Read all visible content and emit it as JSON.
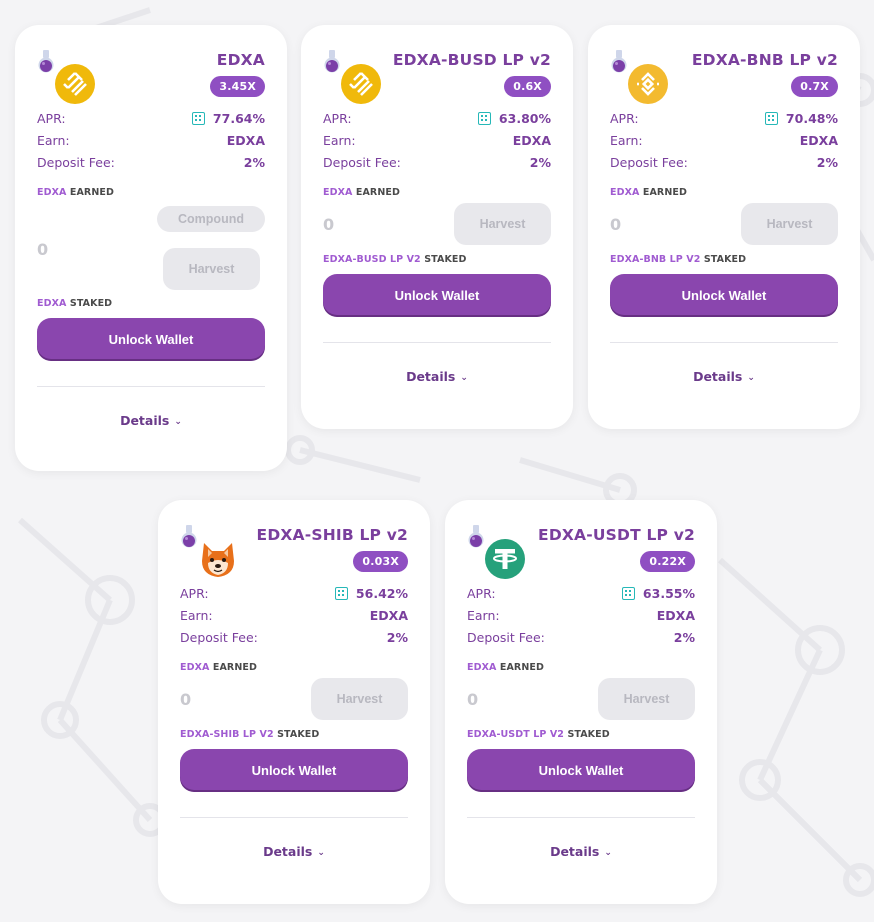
{
  "labels": {
    "apr": "APR:",
    "earn": "Earn:",
    "deposit_fee": "Deposit Fee:",
    "earned_suffix": "EARNED",
    "staked_suffix": "STAKED",
    "unlock_wallet": "Unlock Wallet",
    "details": "Details",
    "harvest": "Harvest",
    "compound": "Compound"
  },
  "colors": {
    "accent_purple": "#8a46ae",
    "title_purple": "#7a3f9d",
    "badge_purple": "#8f4fc2",
    "calc_teal": "#26b8b8",
    "binance_yellow": "#f0b90b",
    "tether_green": "#26a17b"
  },
  "farms": [
    {
      "name": "EDXA",
      "multiplier": "3.45X",
      "apr": "77.64%",
      "earn": "EDXA",
      "deposit_fee": "2%",
      "earned_token": "EDXA",
      "earned_amount": "0",
      "staked_token": "EDXA",
      "icon": "busd-icon"
    },
    {
      "name": "EDXA-BUSD LP v2",
      "multiplier": "0.6X",
      "apr": "63.80%",
      "earn": "EDXA",
      "deposit_fee": "2%",
      "earned_token": "EDXA",
      "earned_amount": "0",
      "staked_token": "EDXA-BUSD LP V2",
      "icon": "busd-icon"
    },
    {
      "name": "EDXA-BNB LP v2",
      "multiplier": "0.7X",
      "apr": "70.48%",
      "earn": "EDXA",
      "deposit_fee": "2%",
      "earned_token": "EDXA",
      "earned_amount": "0",
      "staked_token": "EDXA-BNB LP V2",
      "icon": "bnb-icon"
    },
    {
      "name": "EDXA-SHIB LP v2",
      "multiplier": "0.03X",
      "apr": "56.42%",
      "earn": "EDXA",
      "deposit_fee": "2%",
      "earned_token": "EDXA",
      "earned_amount": "0",
      "staked_token": "EDXA-SHIB LP V2",
      "icon": "shib-icon"
    },
    {
      "name": "EDXA-USDT LP v2",
      "multiplier": "0.22X",
      "apr": "63.55%",
      "earn": "EDXA",
      "deposit_fee": "2%",
      "earned_token": "EDXA",
      "earned_amount": "0",
      "staked_token": "EDXA-USDT LP V2",
      "icon": "usdt-icon"
    }
  ]
}
